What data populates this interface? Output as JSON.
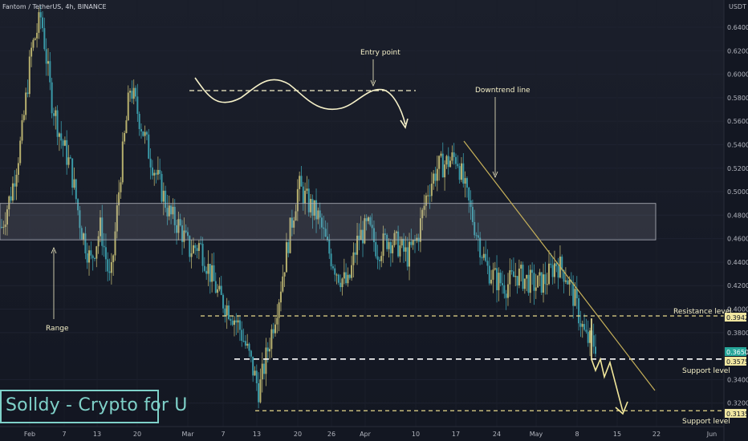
{
  "header": {
    "title": "Fantom / TetherUS, 4h, BINANCE",
    "currency": "USDT"
  },
  "watermark": "Solldy - Crypto for U",
  "chart_data": {
    "type": "candlestick",
    "symbol": "FTM/USDT",
    "interval": "4h",
    "exchange": "BINANCE",
    "ylim": [
      0.3,
      0.66
    ],
    "y_ticks": [
      "0.6400",
      "0.6200",
      "0.6000",
      "0.5800",
      "0.5600",
      "0.5400",
      "0.5200",
      "0.5000",
      "0.4800",
      "0.4600",
      "0.4400",
      "0.4200",
      "0.4000",
      "0.3800",
      "0.3400",
      "0.3200"
    ],
    "x_ticks": [
      "Feb",
      "7",
      "13",
      "20",
      "Mar",
      "7",
      "13",
      "20",
      "26",
      "Apr",
      "10",
      "17",
      "24",
      "May",
      "8",
      "15",
      "22",
      "Jun"
    ],
    "price_badges": {
      "resistance": "0.3942",
      "current": "0.3650",
      "support_1": "0.3575",
      "support_2": "0.3135"
    },
    "levels": {
      "resistance_level": 0.3942,
      "support_level_1": 0.3575,
      "support_level_2": 0.3135,
      "range_high": 0.49,
      "range_low": 0.459
    },
    "series": [
      {
        "name": "FTM/USDT",
        "close": [
          0.47,
          0.5,
          0.545,
          0.62,
          0.65,
          0.58,
          0.545,
          0.52,
          0.47,
          0.44,
          0.47,
          0.42,
          0.515,
          0.59,
          0.56,
          0.53,
          0.505,
          0.48,
          0.47,
          0.45,
          0.455,
          0.432,
          0.41,
          0.4,
          0.385,
          0.36,
          0.33,
          0.37,
          0.41,
          0.46,
          0.505,
          0.49,
          0.478,
          0.45,
          0.43,
          0.42,
          0.46,
          0.47,
          0.45,
          0.46,
          0.455,
          0.445,
          0.46,
          0.5,
          0.52,
          0.525,
          0.53,
          0.495,
          0.465,
          0.435,
          0.425,
          0.42,
          0.43,
          0.425,
          0.42,
          0.425,
          0.44,
          0.43,
          0.405,
          0.375,
          0.37
        ]
      }
    ]
  },
  "annotations": {
    "entry_point": "Entry point",
    "downtrend_line": "Downtrend line",
    "range": "Range",
    "resistance_level": "Resistance level",
    "support_level_1": "Support level",
    "support_level_2": "Support level"
  },
  "colors": {
    "background": "#131722",
    "up_candle": "#b7b06e",
    "down_candle": "#3a9aa8",
    "annotation": "#f5f0c8",
    "trendline": "#c7b15a",
    "range_box": "#b2b5be"
  }
}
